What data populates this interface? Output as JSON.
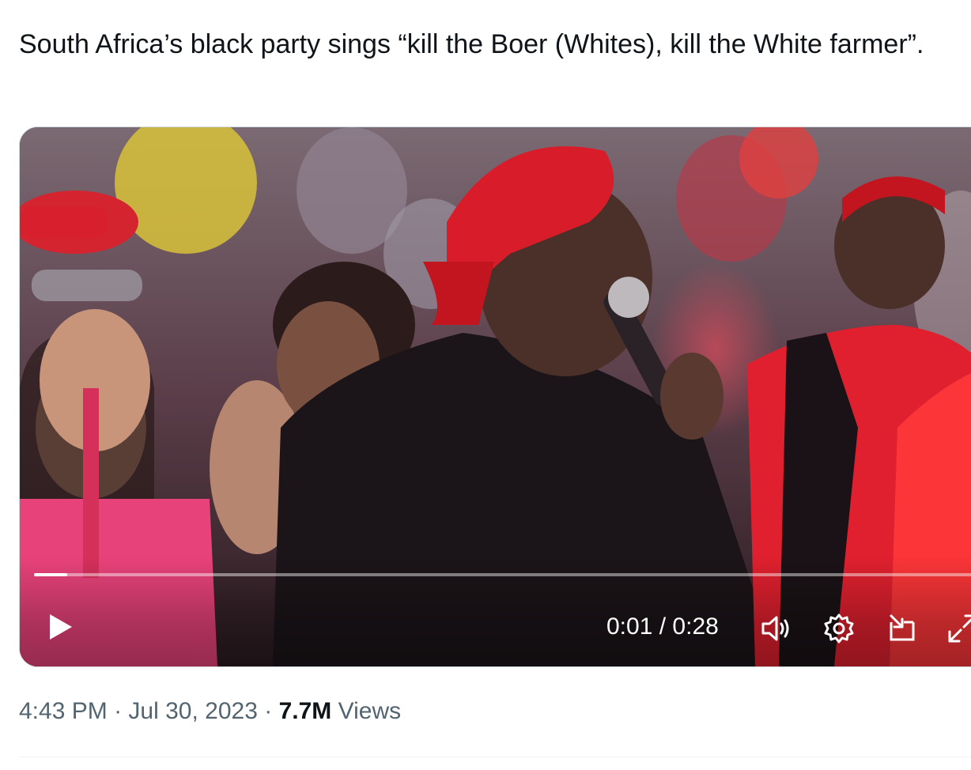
{
  "tweet": {
    "text": "South Africa’s black party sings “kill the Boer (Whites), kill the White farmer”."
  },
  "video": {
    "current_time": "0:01",
    "separator": "/",
    "duration": "0:28",
    "progress_fraction": 0.035,
    "icons": {
      "play": "play-icon",
      "volume": "volume-icon",
      "settings": "gear-icon",
      "pip": "picture-in-picture-icon",
      "fullscreen": "fullscreen-icon"
    }
  },
  "meta": {
    "time": "4:43 PM",
    "dot1": "·",
    "date": "Jul 30, 2023",
    "dot2": "·",
    "views_count": "7.7M",
    "views_label": "Views"
  },
  "colors": {
    "text_primary": "#0f1419",
    "text_secondary": "#536471",
    "border": "#cfd9de"
  }
}
